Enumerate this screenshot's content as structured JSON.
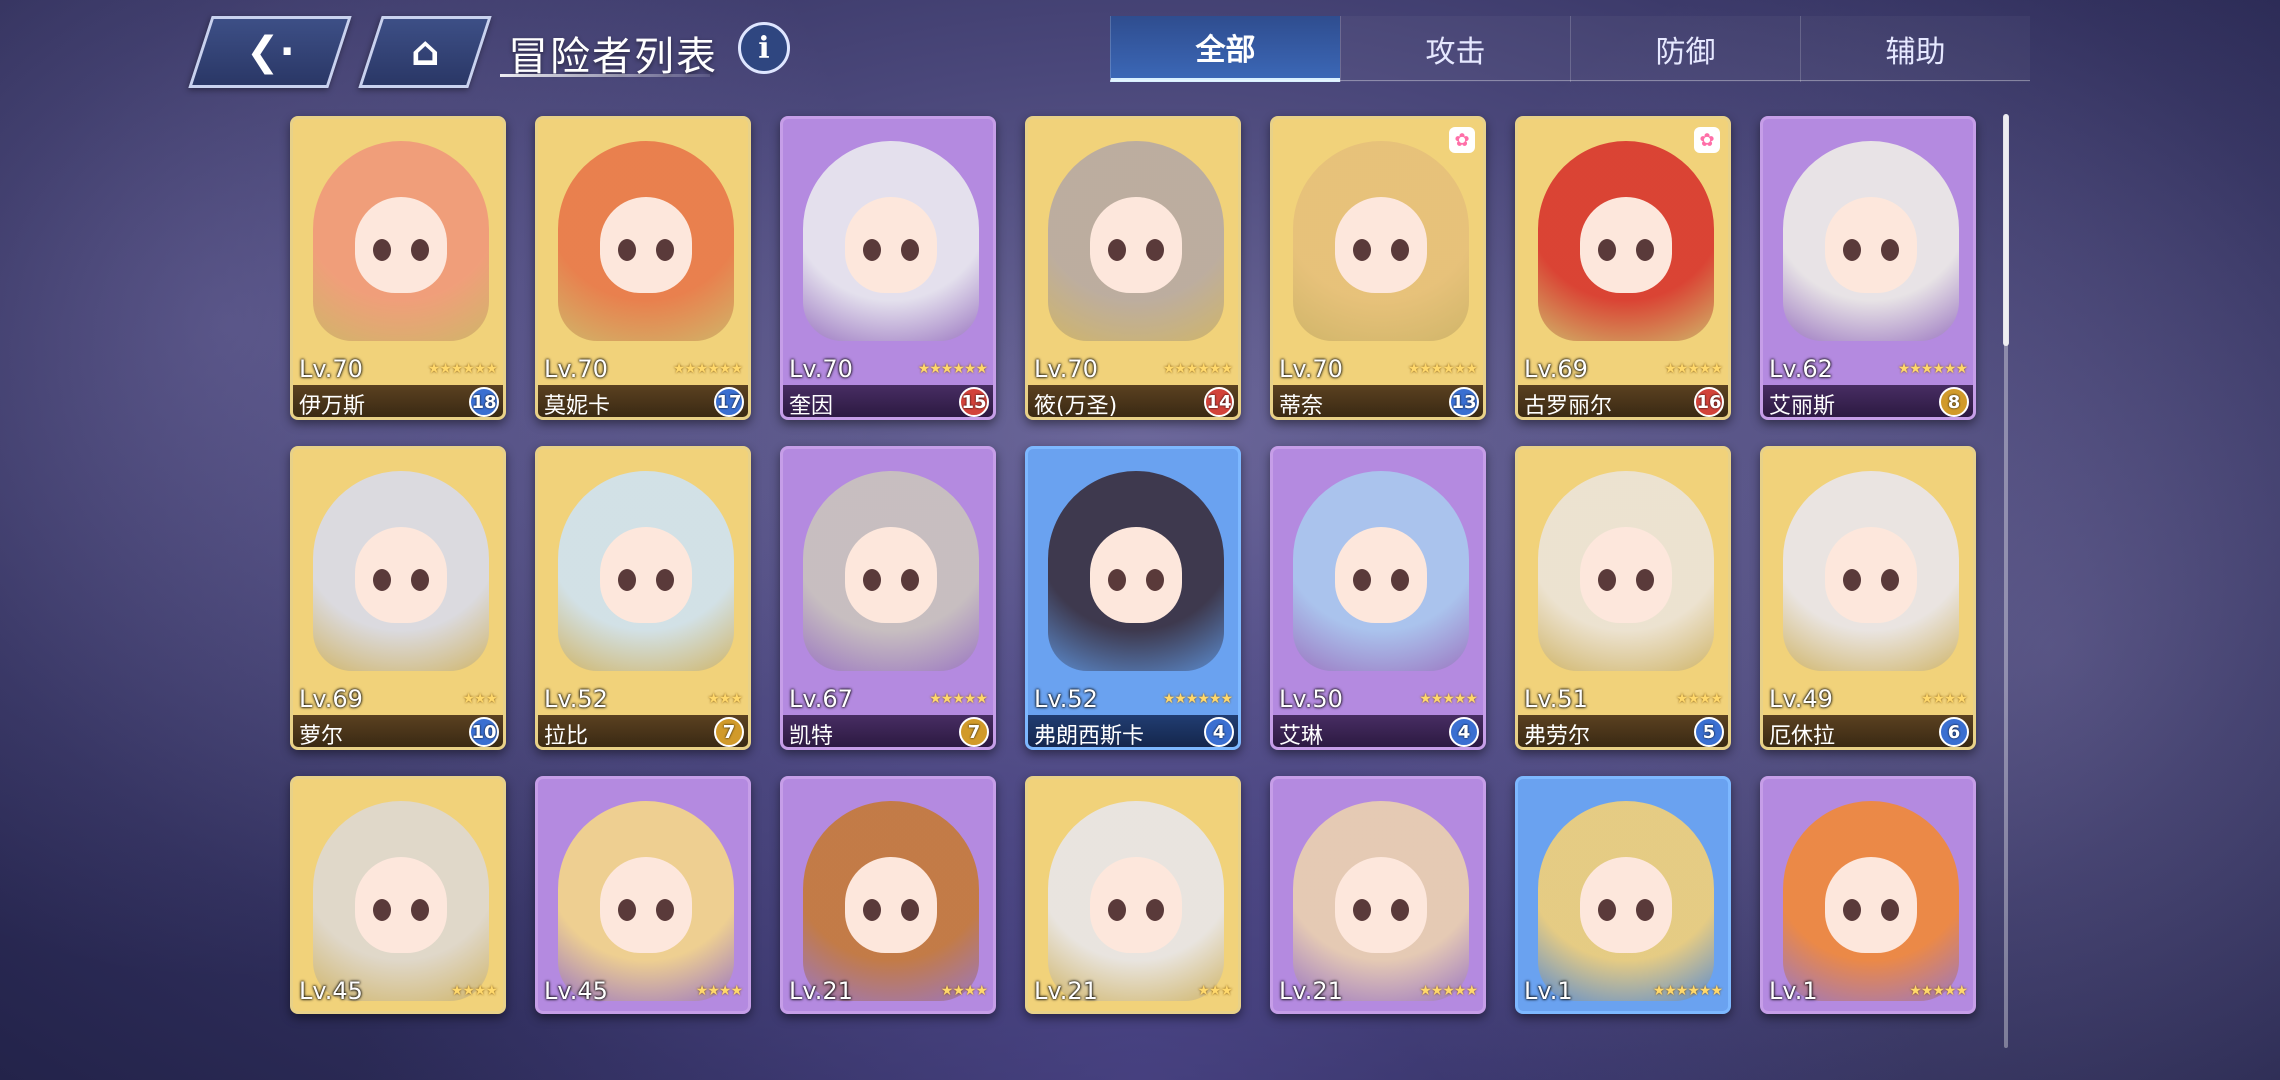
{
  "header": {
    "title": "冒险者列表",
    "back_icon": "back-arrow-icon",
    "home_icon": "home-icon",
    "info_icon": "info-icon",
    "info_glyph": "i"
  },
  "tabs": [
    {
      "label": "全部",
      "active": true
    },
    {
      "label": "攻击",
      "active": false
    },
    {
      "label": "防御",
      "active": false
    },
    {
      "label": "辅助",
      "active": false
    }
  ],
  "cards": [
    {
      "level": "Lv.70",
      "name": "伊万斯",
      "badge": "18",
      "frame": "gold",
      "badge_color": "#3a6fd1",
      "hair": "#f09a7a",
      "stars": "★★★★★★"
    },
    {
      "level": "Lv.70",
      "name": "莫妮卡",
      "badge": "17",
      "frame": "gold",
      "badge_color": "#3a6fd1",
      "hair": "#e8794a",
      "stars": "★★★★★★"
    },
    {
      "level": "Lv.70",
      "name": "奎因",
      "badge": "15",
      "frame": "purple",
      "badge_color": "#d2423a",
      "hair": "#e8e8ee",
      "stars": "★★★★★★"
    },
    {
      "level": "Lv.70",
      "name": "筱(万圣)",
      "badge": "14",
      "frame": "gold",
      "badge_color": "#d2423a",
      "hair": "#b8aaa2",
      "stars": "★★★★★★"
    },
    {
      "level": "Lv.70",
      "name": "蒂奈",
      "badge": "13",
      "frame": "gold",
      "badge_color": "#3a6fd1",
      "hair": "#e6c07a",
      "stars": "★★★★★★",
      "paw": true
    },
    {
      "level": "Lv.69",
      "name": "古罗丽尔",
      "badge": "16",
      "frame": "gold",
      "badge_color": "#d2423a",
      "hair": "#d8372e",
      "stars": "★★★★★",
      "paw": true
    },
    {
      "level": "Lv.62",
      "name": "艾丽斯",
      "badge": "8",
      "frame": "purple",
      "badge_color": "#d19a2a",
      "hair": "#ecebe6",
      "stars": "★★★★★★"
    },
    {
      "level": "Lv.69",
      "name": "萝尔",
      "badge": "10",
      "frame": "gold",
      "badge_color": "#3a6fd1",
      "hair": "#d9dbe8",
      "stars": "★★★"
    },
    {
      "level": "Lv.52",
      "name": "拉比",
      "badge": "7",
      "frame": "gold",
      "badge_color": "#d19a2a",
      "hair": "#cfe2ef",
      "stars": "★★★"
    },
    {
      "level": "Lv.67",
      "name": "凯特",
      "badge": "7",
      "frame": "purple",
      "badge_color": "#d19a2a",
      "hair": "#c9c3bd",
      "stars": "★★★★★"
    },
    {
      "level": "Lv.52",
      "name": "弗朗西斯卡",
      "badge": "4",
      "frame": "blue",
      "badge_color": "#3a6fd1",
      "hair": "#3a3040",
      "stars": "★★★★★★"
    },
    {
      "level": "Lv.50",
      "name": "艾琳",
      "badge": "4",
      "frame": "purple",
      "badge_color": "#3a6fd1",
      "hair": "#a9c8ee",
      "stars": "★★★★★"
    },
    {
      "level": "Lv.51",
      "name": "弗劳尔",
      "badge": "5",
      "frame": "gold",
      "badge_color": "#3a6fd1",
      "hair": "#ece4d8",
      "stars": "★★★★"
    },
    {
      "level": "Lv.49",
      "name": "厄休拉",
      "badge": "6",
      "frame": "gold",
      "badge_color": "#3a6fd1",
      "hair": "#e9e6ea",
      "stars": "★★★★"
    },
    {
      "level": "Lv.45",
      "name": "",
      "badge": "",
      "frame": "gold",
      "badge_color": "",
      "hair": "#ded8d0",
      "stars": "★★★★"
    },
    {
      "level": "Lv.45",
      "name": "",
      "badge": "",
      "frame": "purple",
      "badge_color": "",
      "hair": "#f3d58a",
      "stars": "★★★★"
    },
    {
      "level": "Lv.21",
      "name": "",
      "badge": "",
      "frame": "purple",
      "badge_color": "",
      "hair": "#c47a3a",
      "stars": "★★★★"
    },
    {
      "level": "Lv.21",
      "name": "",
      "badge": "",
      "frame": "gold",
      "badge_color": "",
      "hair": "#e8e6e8",
      "stars": "★★★"
    },
    {
      "level": "Lv.21",
      "name": "",
      "badge": "",
      "frame": "purple",
      "badge_color": "",
      "hair": "#e9cfb0",
      "stars": "★★★★★"
    },
    {
      "level": "Lv.1",
      "name": "",
      "badge": "",
      "frame": "blue",
      "badge_color": "",
      "hair": "#f0cf7a",
      "stars": "★★★★★★"
    },
    {
      "level": "Lv.1",
      "name": "",
      "badge": "",
      "frame": "purple",
      "badge_color": "",
      "hair": "#f0893a",
      "stars": "★★★★★"
    }
  ],
  "card_backgrounds": {
    "gold": "#f1d27a",
    "purple": "#b48ae0",
    "blue": "#6aa2f0"
  }
}
